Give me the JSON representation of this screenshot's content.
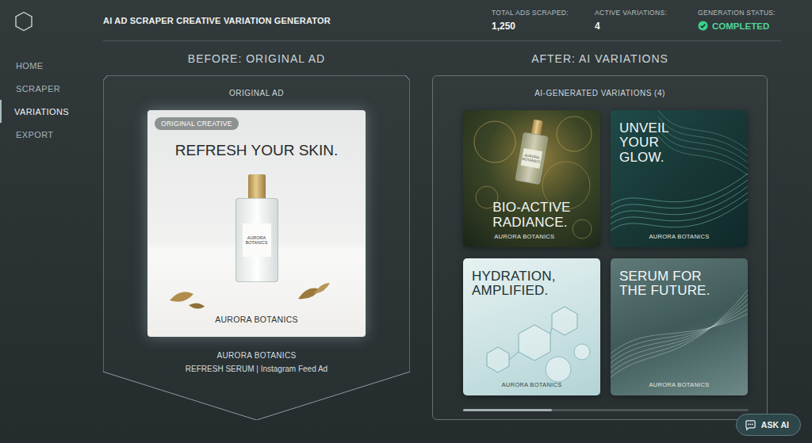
{
  "app": {
    "title": "AI AD SCRAPER CREATIVE VARIATION GENERATOR"
  },
  "sidebar": {
    "items": [
      {
        "label": "HOME",
        "selected": false
      },
      {
        "label": "SCRAPER",
        "selected": false
      },
      {
        "label": "VARIATIONS",
        "selected": true
      },
      {
        "label": "EXPORT",
        "selected": false
      }
    ]
  },
  "stats": [
    {
      "label": "TOTAL ADS SCRAPED:",
      "value": "1,250",
      "kind": "number"
    },
    {
      "label": "ACTIVE VARIATIONS:",
      "value": "4",
      "kind": "number"
    },
    {
      "label": "GENERATION STATUS:",
      "value": "COMPLETED",
      "kind": "status"
    }
  ],
  "before": {
    "heading": "BEFORE: ORIGINAL AD",
    "label": "ORIGINAL AD",
    "ad": {
      "badge": "ORIGINAL CREATIVE",
      "headline": [
        "REFRESH YOUR SKIN."
      ],
      "bottle_label": [
        "AURORA",
        "BOTANICS"
      ],
      "brand": "AURORA BOTANICS"
    },
    "caption": {
      "brand": "AURORA BOTANICS",
      "detail": "REFRESH SERUM | Instagram Feed Ad"
    }
  },
  "after": {
    "heading": "AFTER: AI VARIATIONS",
    "label": "AI-GENERATED VARIATIONS (4)",
    "variations": [
      {
        "kind": "bottle",
        "headline": [
          "BIO-ACTIVE",
          "RADIANCE."
        ],
        "bottle_label": [
          "AURORA",
          "BOTANICS"
        ],
        "brand": "AURORA BOTANICS"
      },
      {
        "kind": "waves",
        "headline": [
          "UNVEIL",
          "YOUR",
          "GLOW."
        ],
        "brand": "AURORA BOTANICS"
      },
      {
        "kind": "crystal",
        "headline": [
          "HYDRATION,",
          "AMPLIFIED."
        ],
        "brand": "AURORA BOTANICS"
      },
      {
        "kind": "flow",
        "headline": [
          "SERUM FOR",
          "THE FUTURE."
        ],
        "brand": "AURORA BOTANICS"
      }
    ],
    "scroll": {
      "level": 0.31
    }
  },
  "ask_ai": {
    "label": "ASK AI"
  }
}
